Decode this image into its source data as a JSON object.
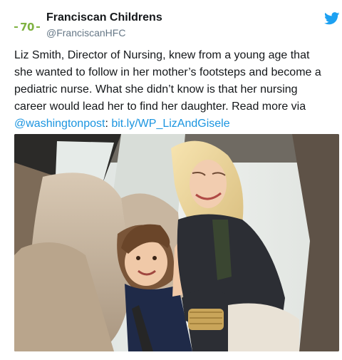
{
  "account": {
    "avatar_text": "70",
    "display_name": "Franciscan Childrens",
    "handle": "@FranciscanHFC"
  },
  "tweet": {
    "body": "Liz Smith, Director of Nursing, knew from a young age that she wanted to follow in her mother’s footsteps and become a pediatric nurse. What she didn’t know is that her nursing career would lead her to find her daughter. Read more via ",
    "mention": "@washingtonpost",
    "separator": ": ",
    "link": "bit.ly/WP_LizAndGisele"
  },
  "icons": {
    "brand": "twitter-bird-icon"
  },
  "colors": {
    "link": "#1b95e0",
    "brand": "#1da1f2",
    "avatar_green": "#7fb241"
  }
}
